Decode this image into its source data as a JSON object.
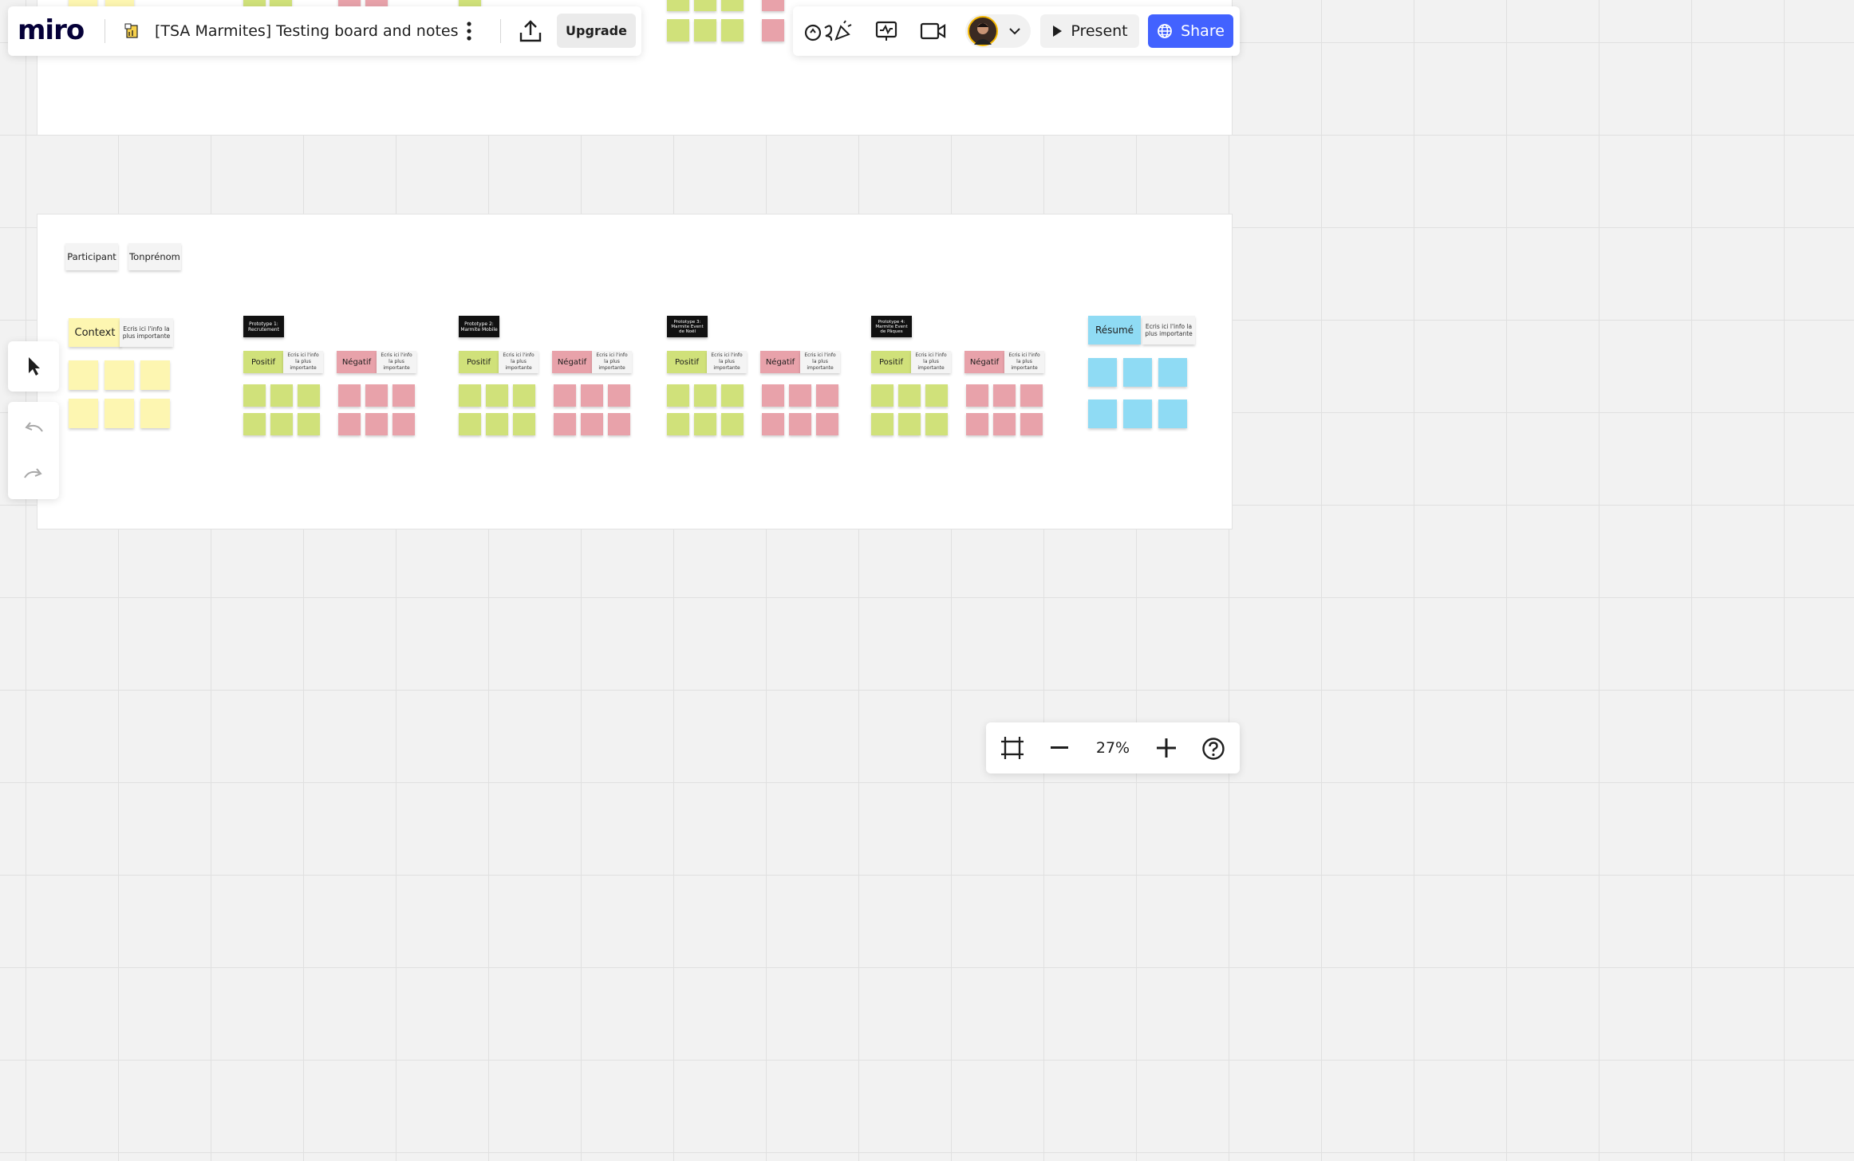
{
  "app": {
    "logo": "miro"
  },
  "board": {
    "title": "[TSA Marmites] Testing board and notes",
    "icon": "board-icon"
  },
  "toolbar": {
    "more_icon": "more-vertical-icon",
    "export_icon": "upload-icon",
    "upgrade_label": "Upgrade",
    "reactions_icon": "reactions-icon",
    "activity_icon": "activity-icon",
    "video_icon": "video-icon",
    "avatar_dropdown_icon": "chevron-down-icon",
    "present_label": "Present",
    "share_label": "Share",
    "share_color": "#4262ff"
  },
  "left_tools": {
    "select_icon": "cursor-icon",
    "undo_icon": "undo-icon",
    "redo_icon": "redo-icon"
  },
  "zoom": {
    "level": "27%",
    "fit_icon": "fit-frame-icon",
    "minus_icon": "minus-icon",
    "plus_icon": "plus-icon",
    "help_icon": "help-icon"
  },
  "canvas": {
    "participant_label": "Participant",
    "participant_value": "Tonprénom",
    "context": {
      "title": "Context",
      "note": "Ecris ici l'info la plus importante"
    },
    "prototypes": [
      {
        "title": "Prototype 1: Recrutement",
        "positive": "Positif",
        "negative": "Négatif",
        "note": "Ecris ici l'info la plus importante"
      },
      {
        "title": "Prototype 2: Marmite Mobile",
        "positive": "Positif",
        "negative": "Négatif",
        "note": "Ecris ici l'info la plus importante"
      },
      {
        "title": "Prototype 3: Marmite Event de Noël",
        "positive": "Positif",
        "negative": "Négatif",
        "note": "Ecris ici l'info la plus importante"
      },
      {
        "title": "Prototype 4: Marmite Event de Pâques",
        "positive": "Positif",
        "negative": "Négatif",
        "note": "Ecris ici l'info la plus importante"
      }
    ],
    "summary": {
      "title": "Résumé",
      "note": "Ecris ici l'info la plus importante"
    }
  },
  "colors": {
    "yellow_sticky": "#fdf6b1",
    "green_sticky": "#d0e17a",
    "red_sticky": "#e8a2aa",
    "blue_sticky": "#8fdbf4"
  }
}
